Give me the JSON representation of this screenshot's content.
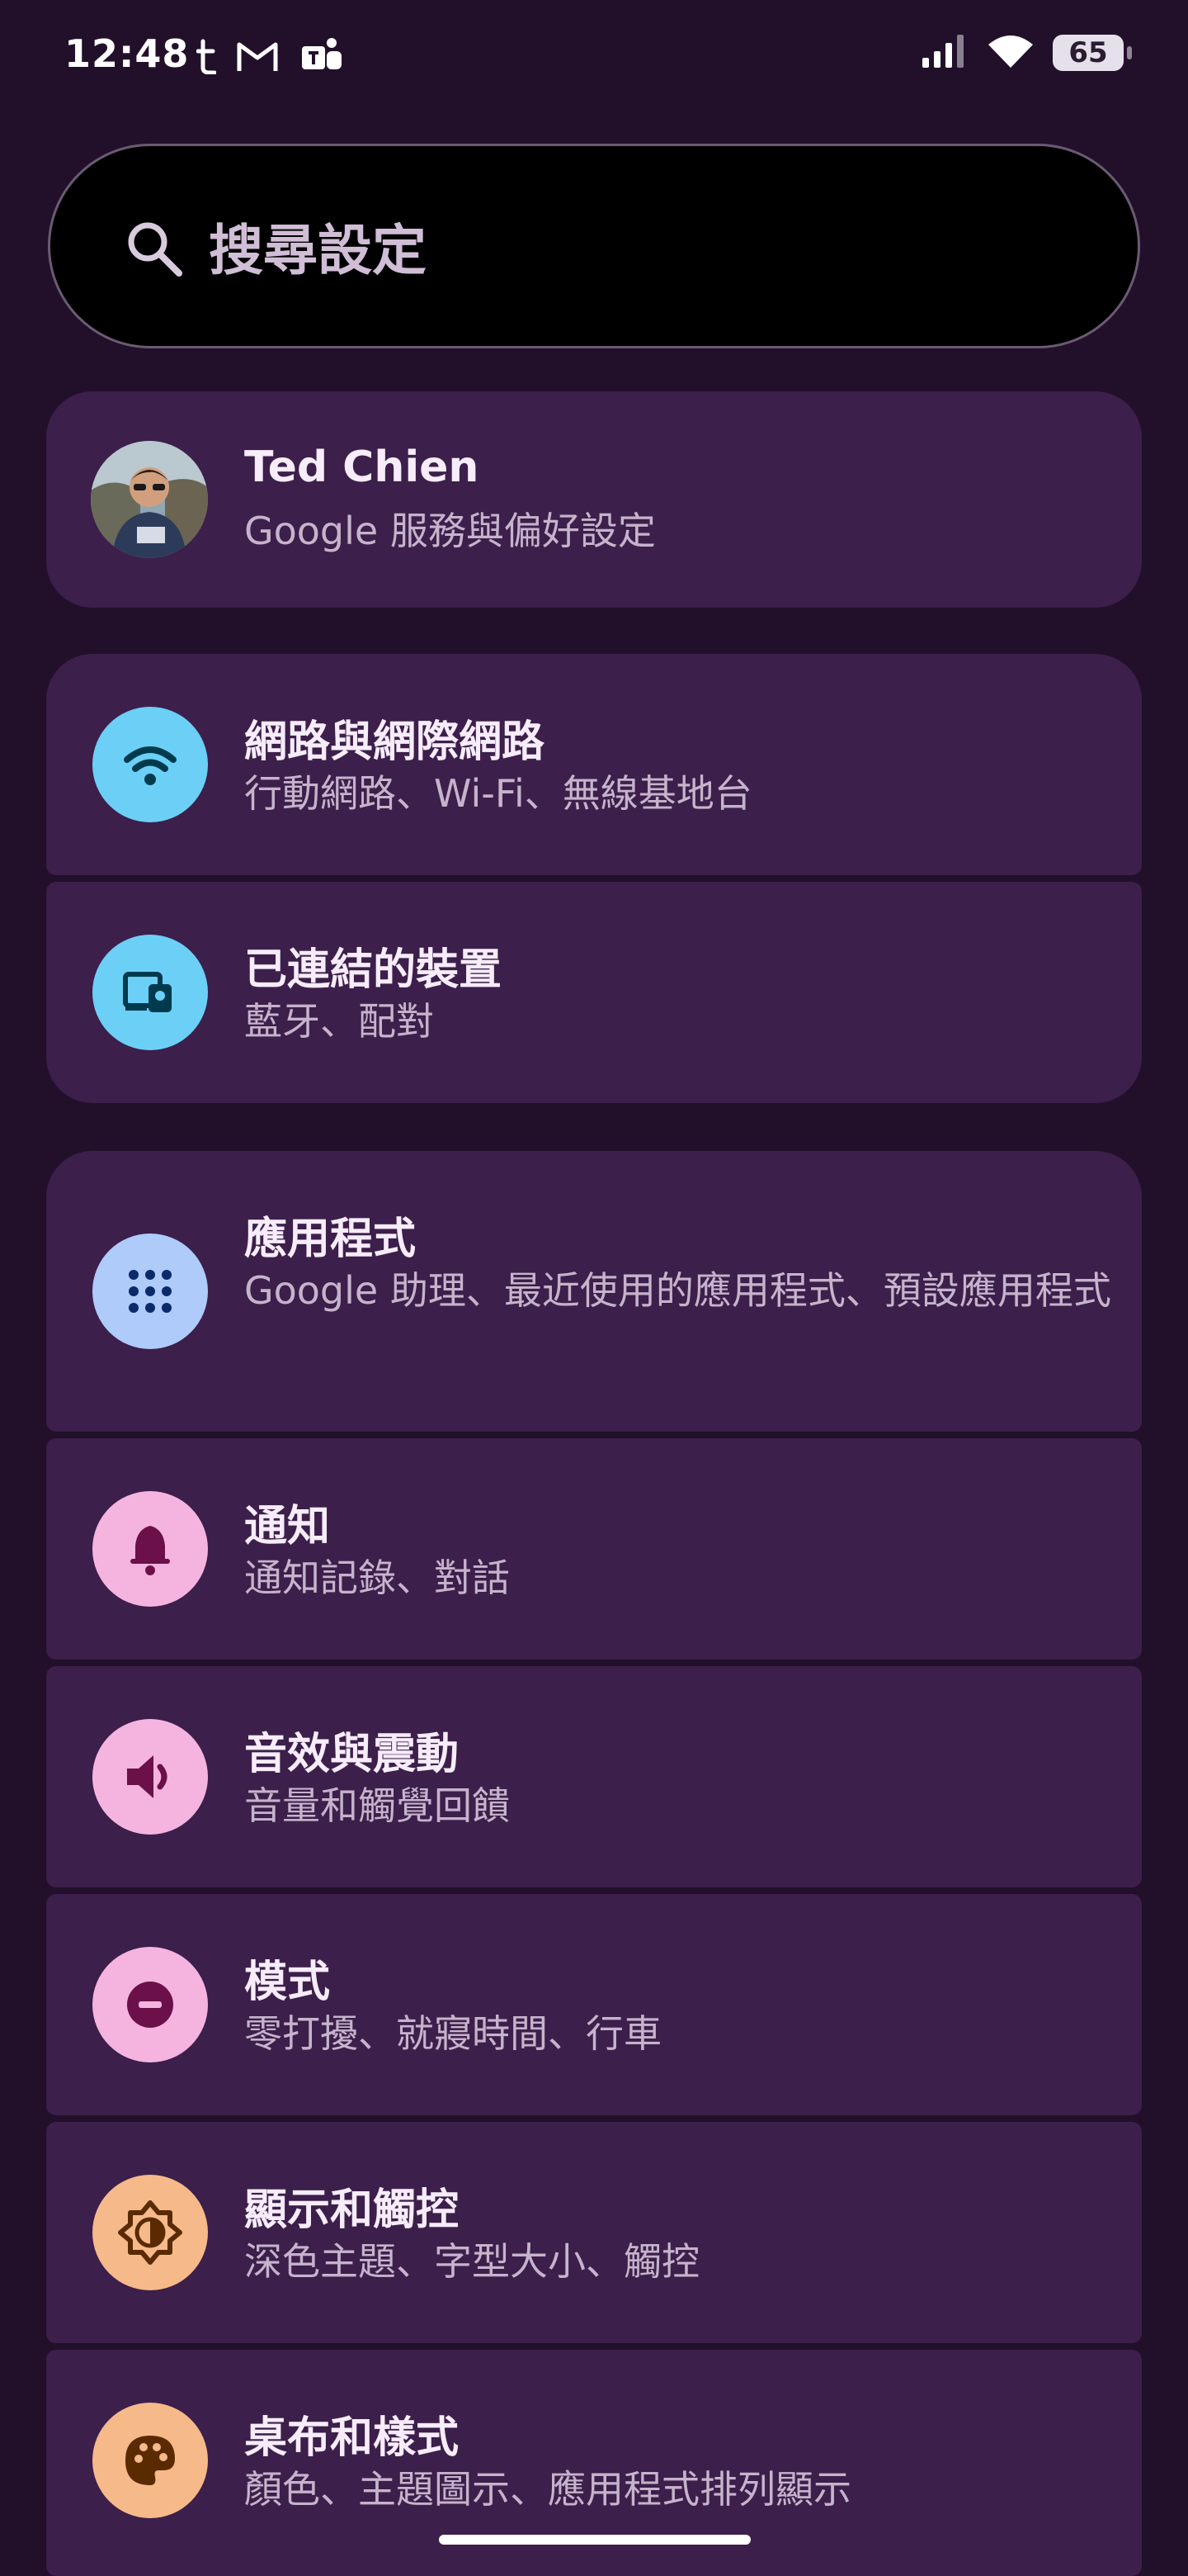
{
  "status_bar": {
    "time": "12:48",
    "left_icons": [
      "tumblr-icon",
      "gmail-icon",
      "teams-icon"
    ],
    "right_icons": [
      "signal-icon",
      "wifi-icon",
      "battery-icon"
    ],
    "battery": "65"
  },
  "search": {
    "placeholder": "搜尋設定"
  },
  "account": {
    "name": "Ted Chien",
    "subtitle": "Google 服務與偏好設定"
  },
  "groups": [
    {
      "items": [
        {
          "title": "網路與網際網路",
          "subtitle": "行動網路、Wi-Fi、無線基地台",
          "icon": "wifi-icon",
          "icon_bg": "#6ccff6",
          "icon_color": "#003a4d"
        },
        {
          "title": "已連結的裝置",
          "subtitle": "藍牙、配對",
          "icon": "connected-devices-icon",
          "icon_bg": "#6ccff6",
          "icon_color": "#003a4d"
        }
      ]
    },
    {
      "items": [
        {
          "title": "應用程式",
          "subtitle": "Google 助理、最近使用的應用程式、預設應用程式",
          "icon": "apps-grid-icon",
          "icon_bg": "#aecbfa",
          "icon_color": "#0b2a6b"
        },
        {
          "title": "通知",
          "subtitle": "通知記錄、對話",
          "icon": "bell-icon",
          "icon_bg": "#f5b4e0",
          "icon_color": "#6b1048"
        },
        {
          "title": "音效與震動",
          "subtitle": "音量和觸覺回饋",
          "icon": "volume-icon",
          "icon_bg": "#f5b4e0",
          "icon_color": "#6b1048"
        },
        {
          "title": "模式",
          "subtitle": "零打擾、就寢時間、行車",
          "icon": "do-not-disturb-icon",
          "icon_bg": "#f5b4e0",
          "icon_color": "#6b1048"
        },
        {
          "title": "顯示和觸控",
          "subtitle": "深色主題、字型大小、觸控",
          "icon": "brightness-icon",
          "icon_bg": "#f6b98a",
          "icon_color": "#5a2a00"
        },
        {
          "title": "桌布和樣式",
          "subtitle": "顏色、主題圖示、應用程式排列顯示",
          "icon": "palette-icon",
          "icon_bg": "#f6b98a",
          "icon_color": "#5a2a00"
        }
      ]
    }
  ],
  "colors": {
    "background": "#22102b",
    "card": "#3c1f4a",
    "search_bg": "#000000"
  }
}
